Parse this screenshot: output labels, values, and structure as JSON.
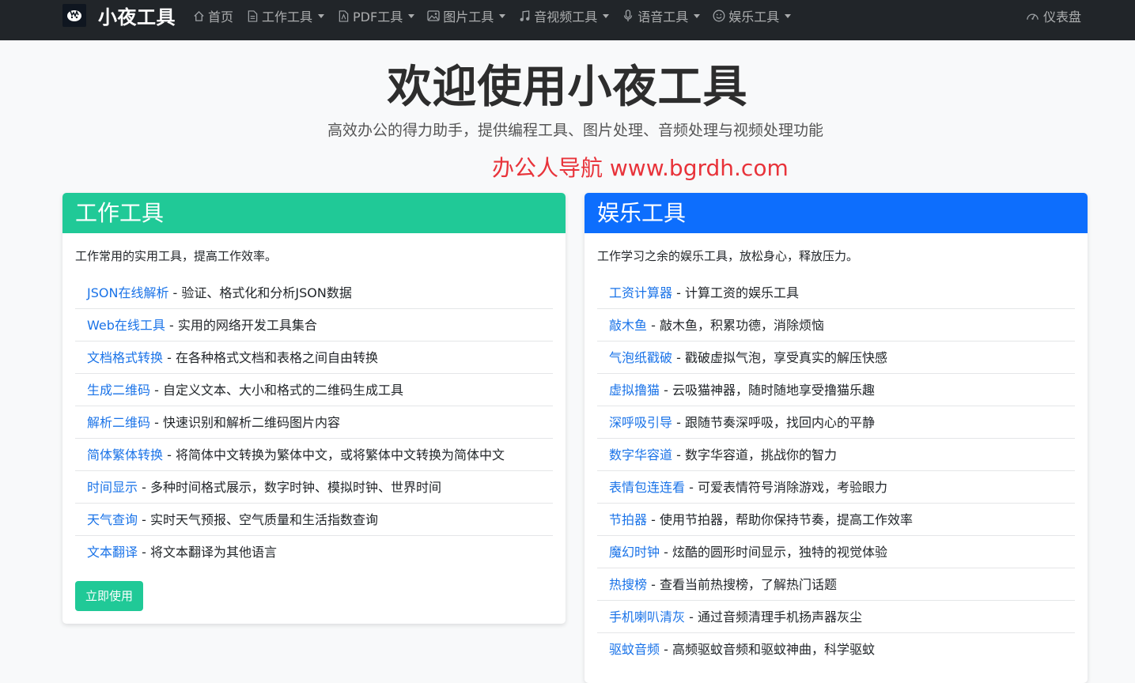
{
  "brand": {
    "name": "小夜工具"
  },
  "nav": {
    "items": [
      {
        "label": "首页",
        "icon": "home-icon",
        "dropdown": false
      },
      {
        "label": "工作工具",
        "icon": "document-icon",
        "dropdown": true
      },
      {
        "label": "PDF工具",
        "icon": "pdf-icon",
        "dropdown": true
      },
      {
        "label": "图片工具",
        "icon": "image-icon",
        "dropdown": true
      },
      {
        "label": "音视频工具",
        "icon": "music-icon",
        "dropdown": true
      },
      {
        "label": "语音工具",
        "icon": "mic-icon",
        "dropdown": true
      },
      {
        "label": "娱乐工具",
        "icon": "smile-icon",
        "dropdown": true
      }
    ],
    "right": {
      "label": "仪表盘",
      "icon": "dashboard-icon"
    }
  },
  "hero": {
    "title": "欢迎使用小夜工具",
    "subtitle": "高效办公的得力助手，提供编程工具、图片处理、音频处理与视频处理功能",
    "promo": "办公人导航  www.bgrdh.com"
  },
  "work_card": {
    "title": "工作工具",
    "description": "工作常用的实用工具，提高工作效率。",
    "button": "立即使用",
    "items": [
      {
        "name": "JSON在线解析",
        "desc": " - 验证、格式化和分析JSON数据"
      },
      {
        "name": "Web在线工具",
        "desc": " - 实用的网络开发工具集合"
      },
      {
        "name": "文档格式转换",
        "desc": " - 在各种格式文档和表格之间自由转换"
      },
      {
        "name": "生成二维码",
        "desc": " - 自定义文本、大小和格式的二维码生成工具"
      },
      {
        "name": "解析二维码",
        "desc": " - 快速识别和解析二维码图片内容"
      },
      {
        "name": "简体繁体转换",
        "desc": " - 将简体中文转换为繁体中文，或将繁体中文转换为简体中文"
      },
      {
        "name": "时间显示",
        "desc": " - 多种时间格式展示，数字时钟、模拟时钟、世界时间"
      },
      {
        "name": "天气查询",
        "desc": " - 实时天气预报、空气质量和生活指数查询"
      },
      {
        "name": "文本翻译",
        "desc": " - 将文本翻译为其他语言"
      }
    ]
  },
  "fun_card": {
    "title": "娱乐工具",
    "description": "工作学习之余的娱乐工具，放松身心，释放压力。",
    "items": [
      {
        "name": "工资计算器",
        "desc": " - 计算工资的娱乐工具"
      },
      {
        "name": "敲木鱼",
        "desc": " - 敲木鱼，积累功德，消除烦恼"
      },
      {
        "name": "气泡纸戳破",
        "desc": " - 戳破虚拟气泡，享受真实的解压快感"
      },
      {
        "name": "虚拟撸猫",
        "desc": " - 云吸猫神器，随时随地享受撸猫乐趣"
      },
      {
        "name": "深呼吸引导",
        "desc": " - 跟随节奏深呼吸，找回内心的平静"
      },
      {
        "name": "数字华容道",
        "desc": " - 数字华容道，挑战你的智力"
      },
      {
        "name": "表情包连连看",
        "desc": " - 可爱表情符号消除游戏，考验眼力"
      },
      {
        "name": "节拍器",
        "desc": " - 使用节拍器，帮助你保持节奏，提高工作效率"
      },
      {
        "name": "魔幻时钟",
        "desc": " - 炫酷的圆形时间显示，独特的视觉体验"
      },
      {
        "name": "热搜榜",
        "desc": " - 查看当前热搜榜，了解热门话题"
      },
      {
        "name": "手机喇叭清灰",
        "desc": " - 通过音频清理手机扬声器灰尘"
      },
      {
        "name": "驱蚊音频",
        "desc": " - 高频驱蚊音频和驱蚊神曲，科学驱蚊"
      }
    ]
  }
}
